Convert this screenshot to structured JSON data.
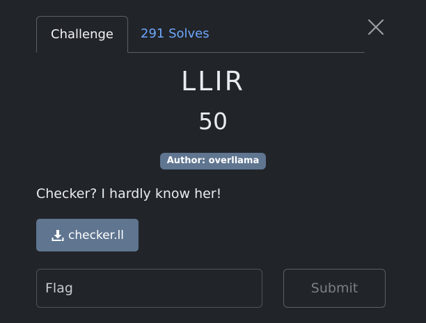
{
  "tabs": [
    {
      "label": "Challenge",
      "active": true
    },
    {
      "label": "291 Solves",
      "active": false
    }
  ],
  "challenge": {
    "name": "LLIR",
    "points": "50",
    "author": "Author: overllama",
    "description": "Checker? I hardly know her!",
    "file_label": "checker.ll"
  },
  "flag": {
    "placeholder": "Flag",
    "value": ""
  },
  "submit_label": "Submit",
  "colors": {
    "background": "#212429",
    "accent_link": "#6ea8fe",
    "badge": "#5f7590",
    "button": "#5f7590"
  },
  "icons": {
    "close": "close-icon",
    "download": "download-icon"
  }
}
